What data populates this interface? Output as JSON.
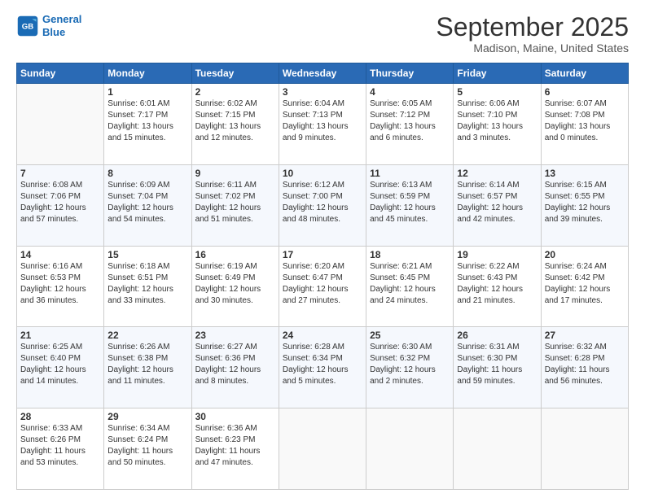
{
  "header": {
    "logo_line1": "General",
    "logo_line2": "Blue",
    "month": "September 2025",
    "location": "Madison, Maine, United States"
  },
  "weekdays": [
    "Sunday",
    "Monday",
    "Tuesday",
    "Wednesday",
    "Thursday",
    "Friday",
    "Saturday"
  ],
  "weeks": [
    [
      {
        "day": "",
        "text": ""
      },
      {
        "day": "1",
        "text": "Sunrise: 6:01 AM\nSunset: 7:17 PM\nDaylight: 13 hours\nand 15 minutes."
      },
      {
        "day": "2",
        "text": "Sunrise: 6:02 AM\nSunset: 7:15 PM\nDaylight: 13 hours\nand 12 minutes."
      },
      {
        "day": "3",
        "text": "Sunrise: 6:04 AM\nSunset: 7:13 PM\nDaylight: 13 hours\nand 9 minutes."
      },
      {
        "day": "4",
        "text": "Sunrise: 6:05 AM\nSunset: 7:12 PM\nDaylight: 13 hours\nand 6 minutes."
      },
      {
        "day": "5",
        "text": "Sunrise: 6:06 AM\nSunset: 7:10 PM\nDaylight: 13 hours\nand 3 minutes."
      },
      {
        "day": "6",
        "text": "Sunrise: 6:07 AM\nSunset: 7:08 PM\nDaylight: 13 hours\nand 0 minutes."
      }
    ],
    [
      {
        "day": "7",
        "text": "Sunrise: 6:08 AM\nSunset: 7:06 PM\nDaylight: 12 hours\nand 57 minutes."
      },
      {
        "day": "8",
        "text": "Sunrise: 6:09 AM\nSunset: 7:04 PM\nDaylight: 12 hours\nand 54 minutes."
      },
      {
        "day": "9",
        "text": "Sunrise: 6:11 AM\nSunset: 7:02 PM\nDaylight: 12 hours\nand 51 minutes."
      },
      {
        "day": "10",
        "text": "Sunrise: 6:12 AM\nSunset: 7:00 PM\nDaylight: 12 hours\nand 48 minutes."
      },
      {
        "day": "11",
        "text": "Sunrise: 6:13 AM\nSunset: 6:59 PM\nDaylight: 12 hours\nand 45 minutes."
      },
      {
        "day": "12",
        "text": "Sunrise: 6:14 AM\nSunset: 6:57 PM\nDaylight: 12 hours\nand 42 minutes."
      },
      {
        "day": "13",
        "text": "Sunrise: 6:15 AM\nSunset: 6:55 PM\nDaylight: 12 hours\nand 39 minutes."
      }
    ],
    [
      {
        "day": "14",
        "text": "Sunrise: 6:16 AM\nSunset: 6:53 PM\nDaylight: 12 hours\nand 36 minutes."
      },
      {
        "day": "15",
        "text": "Sunrise: 6:18 AM\nSunset: 6:51 PM\nDaylight: 12 hours\nand 33 minutes."
      },
      {
        "day": "16",
        "text": "Sunrise: 6:19 AM\nSunset: 6:49 PM\nDaylight: 12 hours\nand 30 minutes."
      },
      {
        "day": "17",
        "text": "Sunrise: 6:20 AM\nSunset: 6:47 PM\nDaylight: 12 hours\nand 27 minutes."
      },
      {
        "day": "18",
        "text": "Sunrise: 6:21 AM\nSunset: 6:45 PM\nDaylight: 12 hours\nand 24 minutes."
      },
      {
        "day": "19",
        "text": "Sunrise: 6:22 AM\nSunset: 6:43 PM\nDaylight: 12 hours\nand 21 minutes."
      },
      {
        "day": "20",
        "text": "Sunrise: 6:24 AM\nSunset: 6:42 PM\nDaylight: 12 hours\nand 17 minutes."
      }
    ],
    [
      {
        "day": "21",
        "text": "Sunrise: 6:25 AM\nSunset: 6:40 PM\nDaylight: 12 hours\nand 14 minutes."
      },
      {
        "day": "22",
        "text": "Sunrise: 6:26 AM\nSunset: 6:38 PM\nDaylight: 12 hours\nand 11 minutes."
      },
      {
        "day": "23",
        "text": "Sunrise: 6:27 AM\nSunset: 6:36 PM\nDaylight: 12 hours\nand 8 minutes."
      },
      {
        "day": "24",
        "text": "Sunrise: 6:28 AM\nSunset: 6:34 PM\nDaylight: 12 hours\nand 5 minutes."
      },
      {
        "day": "25",
        "text": "Sunrise: 6:30 AM\nSunset: 6:32 PM\nDaylight: 12 hours\nand 2 minutes."
      },
      {
        "day": "26",
        "text": "Sunrise: 6:31 AM\nSunset: 6:30 PM\nDaylight: 11 hours\nand 59 minutes."
      },
      {
        "day": "27",
        "text": "Sunrise: 6:32 AM\nSunset: 6:28 PM\nDaylight: 11 hours\nand 56 minutes."
      }
    ],
    [
      {
        "day": "28",
        "text": "Sunrise: 6:33 AM\nSunset: 6:26 PM\nDaylight: 11 hours\nand 53 minutes."
      },
      {
        "day": "29",
        "text": "Sunrise: 6:34 AM\nSunset: 6:24 PM\nDaylight: 11 hours\nand 50 minutes."
      },
      {
        "day": "30",
        "text": "Sunrise: 6:36 AM\nSunset: 6:23 PM\nDaylight: 11 hours\nand 47 minutes."
      },
      {
        "day": "",
        "text": ""
      },
      {
        "day": "",
        "text": ""
      },
      {
        "day": "",
        "text": ""
      },
      {
        "day": "",
        "text": ""
      }
    ]
  ]
}
